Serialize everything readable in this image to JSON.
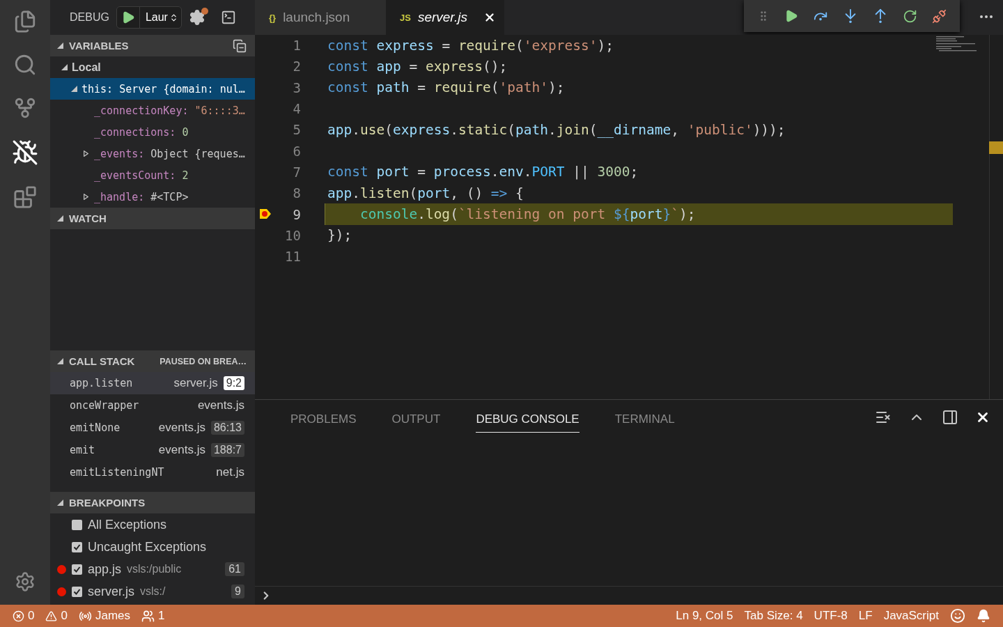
{
  "sidebar": {
    "title": "DEBUG",
    "config": "Laur",
    "sections": [
      {
        "kind": "variables",
        "title": "VARIABLES",
        "expanded": true,
        "scopes": [
          {
            "name": "Local",
            "expanded": true,
            "children": [
              {
                "name": "this:",
                "value": "Server {domain: nul…",
                "expanded": true,
                "selected": true,
                "children": [
                  {
                    "name": "_connectionKey:",
                    "value": "\"6::::3…",
                    "kind": "string"
                  },
                  {
                    "name": "_connections:",
                    "value": "0",
                    "kind": "number"
                  },
                  {
                    "name": "_events:",
                    "value": "Object {reques…",
                    "kind": "object",
                    "expanded": false
                  },
                  {
                    "name": "_eventsCount:",
                    "value": "2",
                    "kind": "number"
                  },
                  {
                    "name": "_handle:",
                    "value": "#<TCP>",
                    "kind": "object",
                    "expanded": false
                  }
                ]
              }
            ]
          }
        ]
      },
      {
        "kind": "watch",
        "title": "WATCH",
        "expanded": true
      },
      {
        "kind": "callstack",
        "title": "CALL STACK",
        "status": "PAUSED ON BREA…",
        "expanded": true,
        "frames": [
          {
            "name": "app.listen",
            "file": "server.js",
            "location": "9:2",
            "selected": true
          },
          {
            "name": "onceWrapper",
            "file": "events.js",
            "selected": false
          },
          {
            "name": "emitNone",
            "file": "events.js",
            "location": "86:13",
            "selected": false
          },
          {
            "name": "emit",
            "file": "events.js",
            "location": "188:7",
            "selected": false
          },
          {
            "name": "emitListeningNT",
            "file": "net.js",
            "selected": false
          }
        ]
      },
      {
        "kind": "breakpoints",
        "title": "BREAKPOINTS",
        "expanded": true,
        "items": [
          {
            "kind": "exception",
            "label": "All Exceptions",
            "checked": false
          },
          {
            "kind": "exception",
            "label": "Uncaught Exceptions",
            "checked": true
          },
          {
            "kind": "file",
            "label": "app.js",
            "path": "vsls:/public",
            "line": "61",
            "checked": true
          },
          {
            "kind": "file",
            "label": "server.js",
            "path": "vsls:/",
            "line": "9",
            "checked": true
          }
        ]
      }
    ]
  },
  "tabs": [
    {
      "icon": "{}",
      "label": "launch.json",
      "selected": false
    },
    {
      "icon": "JS",
      "label": "server.js",
      "selected": true
    }
  ],
  "editor": {
    "lines": [
      {
        "number": "1",
        "tokens": [
          {
            "t": "const ",
            "kind": "keyword"
          },
          {
            "t": "express",
            "kind": "variable"
          },
          {
            "t": " = ",
            "kind": "plain"
          },
          {
            "t": "require",
            "kind": "function"
          },
          {
            "t": "(",
            "kind": "plain"
          },
          {
            "t": "'express'",
            "kind": "string"
          },
          {
            "t": ");",
            "kind": "plain"
          }
        ]
      },
      {
        "number": "2",
        "tokens": [
          {
            "t": "const ",
            "kind": "keyword"
          },
          {
            "t": "app",
            "kind": "variable"
          },
          {
            "t": " = ",
            "kind": "plain"
          },
          {
            "t": "express",
            "kind": "function"
          },
          {
            "t": "();",
            "kind": "plain"
          }
        ]
      },
      {
        "number": "3",
        "tokens": [
          {
            "t": "const ",
            "kind": "keyword"
          },
          {
            "t": "path",
            "kind": "variable"
          },
          {
            "t": " = ",
            "kind": "plain"
          },
          {
            "t": "require",
            "kind": "function"
          },
          {
            "t": "(",
            "kind": "plain"
          },
          {
            "t": "'path'",
            "kind": "string"
          },
          {
            "t": ");",
            "kind": "plain"
          }
        ]
      },
      {
        "number": "4"
      },
      {
        "number": "5",
        "tokens": [
          {
            "t": "app",
            "kind": "variable"
          },
          {
            "t": ".",
            "kind": "plain"
          },
          {
            "t": "use",
            "kind": "function"
          },
          {
            "t": "(",
            "kind": "plain"
          },
          {
            "t": "express",
            "kind": "variable"
          },
          {
            "t": ".",
            "kind": "plain"
          },
          {
            "t": "static",
            "kind": "function"
          },
          {
            "t": "(",
            "kind": "plain"
          },
          {
            "t": "path",
            "kind": "variable"
          },
          {
            "t": ".",
            "kind": "plain"
          },
          {
            "t": "join",
            "kind": "function"
          },
          {
            "t": "(",
            "kind": "plain"
          },
          {
            "t": "__dirname",
            "kind": "variable"
          },
          {
            "t": ", ",
            "kind": "plain"
          },
          {
            "t": "'public'",
            "kind": "string"
          },
          {
            "t": ")));",
            "kind": "plain"
          }
        ]
      },
      {
        "number": "6"
      },
      {
        "number": "7",
        "tokens": [
          {
            "t": "const ",
            "kind": "keyword"
          },
          {
            "t": "port",
            "kind": "variable"
          },
          {
            "t": " = ",
            "kind": "plain"
          },
          {
            "t": "process",
            "kind": "variable"
          },
          {
            "t": ".",
            "kind": "plain"
          },
          {
            "t": "env",
            "kind": "variable"
          },
          {
            "t": ".",
            "kind": "plain"
          },
          {
            "t": "PORT",
            "kind": "constant"
          },
          {
            "t": " || ",
            "kind": "plain"
          },
          {
            "t": "3000",
            "kind": "number"
          },
          {
            "t": ";",
            "kind": "plain"
          }
        ]
      },
      {
        "number": "8",
        "tokens": [
          {
            "t": "app",
            "kind": "variable"
          },
          {
            "t": ".",
            "kind": "plain"
          },
          {
            "t": "listen",
            "kind": "function"
          },
          {
            "t": "(",
            "kind": "plain"
          },
          {
            "t": "port",
            "kind": "variable"
          },
          {
            "t": ", () ",
            "kind": "plain"
          },
          {
            "t": "=>",
            "kind": "keyword"
          },
          {
            "t": " {",
            "kind": "plain"
          }
        ]
      },
      {
        "number": "9",
        "paused": true,
        "tokens": [
          {
            "t": "    console",
            "kind": "class"
          },
          {
            "t": ".",
            "kind": "plain"
          },
          {
            "t": "log",
            "kind": "function"
          },
          {
            "t": "(",
            "kind": "plain"
          },
          {
            "t": "`listening on port ",
            "kind": "string"
          },
          {
            "t": "${",
            "kind": "keyword"
          },
          {
            "t": "port",
            "kind": "variable"
          },
          {
            "t": "}",
            "kind": "keyword"
          },
          {
            "t": "`",
            "kind": "string"
          },
          {
            "t": ");",
            "kind": "plain"
          }
        ]
      },
      {
        "number": "10",
        "tokens": [
          {
            "t": "});",
            "kind": "plain"
          }
        ]
      },
      {
        "number": "11"
      }
    ]
  },
  "panel": {
    "tabs": [
      {
        "label": "PROBLEMS",
        "selected": false
      },
      {
        "label": "OUTPUT",
        "selected": false
      },
      {
        "label": "DEBUG CONSOLE",
        "selected": true
      },
      {
        "label": "TERMINAL",
        "selected": false
      }
    ]
  },
  "status_bar": {
    "left": [
      {
        "kind": "errors",
        "text": "0"
      },
      {
        "kind": "warnings",
        "text": "0"
      },
      {
        "kind": "share",
        "text": "James"
      },
      {
        "kind": "participants",
        "text": "1"
      }
    ],
    "right": [
      {
        "kind": "text",
        "text": "Ln 9, Col 5"
      },
      {
        "kind": "text",
        "text": "Tab Size: 4"
      },
      {
        "kind": "text",
        "text": "UTF-8"
      },
      {
        "kind": "text",
        "text": "LF"
      },
      {
        "kind": "text",
        "text": "JavaScript"
      },
      {
        "kind": "feedback"
      },
      {
        "kind": "notifications"
      }
    ]
  }
}
